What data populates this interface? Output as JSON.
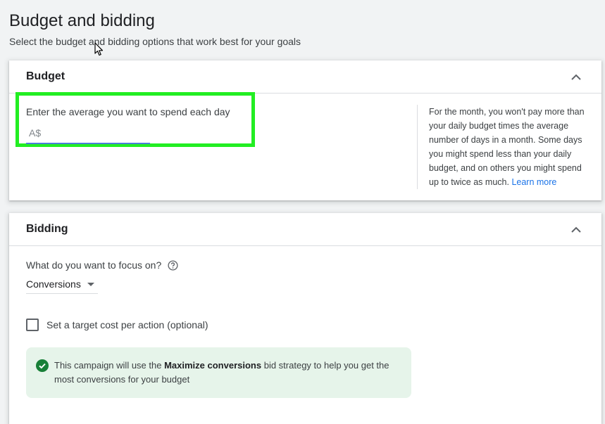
{
  "page": {
    "title": "Budget and bidding",
    "subtitle": "Select the budget and bidding options that work best for your goals"
  },
  "budget": {
    "header": "Budget",
    "collapse_icon": "chevron-up-icon",
    "input_label": "Enter the average you want to spend each day",
    "input_placeholder": "A$",
    "input_value": "",
    "help_text": "For the month, you won't pay more than your daily budget times the average number of days in a month. Some days you might spend less than your daily budget, and on others you might spend up to twice as much.",
    "learn_more": "Learn more",
    "highlight_color": "#22ee22"
  },
  "bidding": {
    "header": "Bidding",
    "collapse_icon": "chevron-up-icon",
    "focus_question": "What do you want to focus on?",
    "focus_help_icon": "help-circle-icon",
    "focus_value": "Conversions",
    "target_cpa_label": "Set a target cost per action (optional)",
    "target_cpa_checked": false,
    "strategy_prefix": "This campaign will use the",
    "strategy_name": "Maximize conversions",
    "strategy_suffix": "bid strategy to help you get the most conversions for your budget",
    "strategy_icon": "check-circle-icon"
  },
  "colors": {
    "accent": "#1a73e8",
    "success": "#188038",
    "success_bg": "#e6f4ea",
    "input_underline": "#4a7fd6"
  }
}
